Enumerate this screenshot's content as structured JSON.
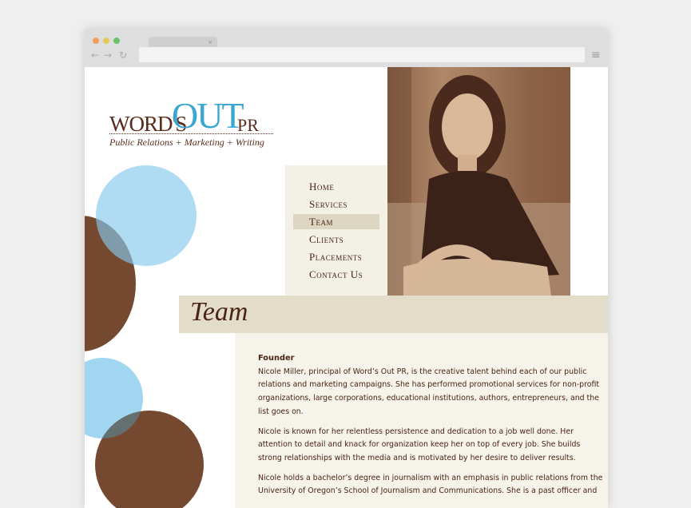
{
  "browser": {
    "tab_close": "×",
    "back": "←",
    "forward": "→",
    "reload": "↻",
    "menu": "≡"
  },
  "colors": {
    "brown": "#75492f",
    "blue": "#3aa6d2",
    "light_blue": "#a9d9f0"
  },
  "logo": {
    "words": "WORD'S",
    "out": "OUT",
    "pr": "PR",
    "tagline": "Public Relations + Marketing + Writing"
  },
  "nav": [
    {
      "label": "Home"
    },
    {
      "label": "Services"
    },
    {
      "label": "Team",
      "active": true
    },
    {
      "label": "Clients"
    },
    {
      "label": "Placements"
    },
    {
      "label": "Contact Us"
    }
  ],
  "section_title": "Team",
  "content": {
    "heading": "Founder",
    "paragraphs": [
      [
        "Nicole Miller, principal of Word’s Out PR, is the creative talent behind each of our public",
        "relations and marketing campaigns. She has performed promotional services for non-profit",
        "organizations, large corporations, educational institutions, authors, entrepreneurs, and the",
        "list goes on."
      ],
      [
        "Nicole is known for her relentless persistence and dedication to a job well done. Her",
        "attention to detail and knack for organization keep her on top of every job. She builds",
        "strong relationships with the media and is motivated by her desire to deliver results."
      ],
      [
        "Nicole holds a bachelor’s degree in journalism with an emphasis in public relations from the",
        "University of Oregon’s School of Journalism and Communications. She is a past officer and"
      ]
    ]
  }
}
